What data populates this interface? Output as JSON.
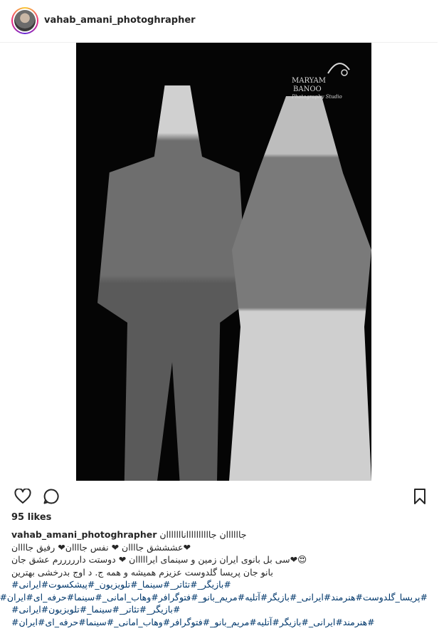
{
  "post": {
    "username": "vahab_amani_photoghrapher",
    "likes": "95 likes",
    "watermark": {
      "top": "MARYAM",
      "middle": "BANOO",
      "bottom": "Photography Studio"
    },
    "caption": {
      "username": "vahab_amani_photoghrapher",
      "lines": [
        "جاااااان جاااااااااانااااااان",
        "❤عشششق جاااان ❤ نفس جاااان❤ رفیق جاااان",
        "😍❤سی بل بانوی ایران زمین و سینمای ایرااااان ❤ دوستت دارررررم عشق جان",
        "بانو جان پریسا گلدوست عزیزم همیشه و همه ج. د اوج بدرخشی بهترین",
        "#بازیگر_#تئاتر_#سینما_#تلویزیون_#پیشکسوت#ایرانی#"
      ],
      "hashtag_lines": [
        "#پریسا_گلدوست#هنرمند#ایرانی_#بازیگر#آتلیه#مریم_بانو_#فتوگرافر#وهاب_امانی_#سینما#حرفه_ای#ایران#",
        "#بازیگر_#تئاتر_#سینما_#تلویزیون#ایرانی#",
        "#هنرمند#ایرانی_#بازیگر#آتلیه#مریم_بانو_#فتوگرافر#وهاب_امانی_#سینما#حرفه_ای#ایران#"
      ]
    }
  }
}
